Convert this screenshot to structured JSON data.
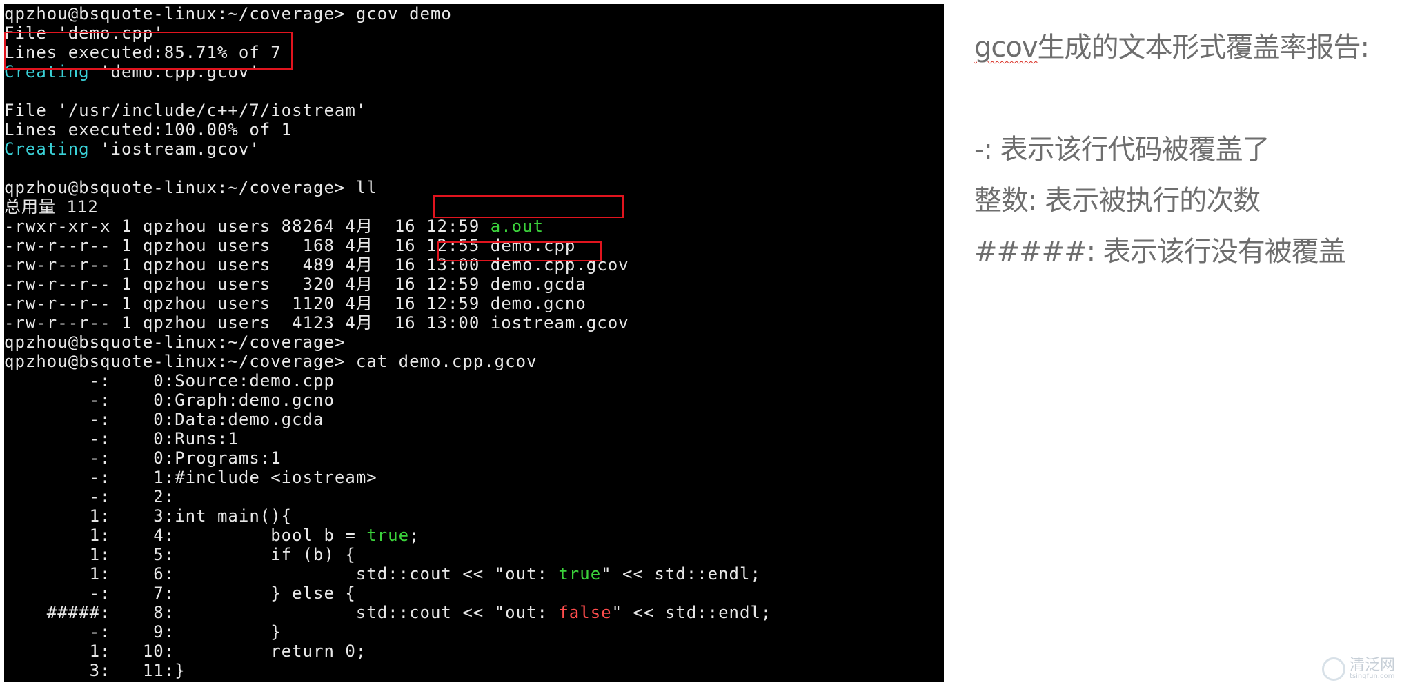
{
  "terminal": {
    "lines": [
      [
        {
          "t": "qpzhou@bsquote-linux:~/coverage> gcov demo",
          "c": "default"
        }
      ],
      [
        {
          "t": "File 'demo.cpp'",
          "c": "default"
        }
      ],
      [
        {
          "t": "Lines executed:85.71% of 7",
          "c": "default"
        }
      ],
      [
        {
          "t": "Creating",
          "c": "cyan"
        },
        {
          "t": " 'demo.cpp.gcov'",
          "c": "default"
        }
      ],
      [],
      [
        {
          "t": "File '/usr/include/c++/7/iostream'",
          "c": "default"
        }
      ],
      [
        {
          "t": "Lines executed:100.00% of 1",
          "c": "default"
        }
      ],
      [
        {
          "t": "Creating",
          "c": "cyan"
        },
        {
          "t": " 'iostream.gcov'",
          "c": "default"
        }
      ],
      [],
      [
        {
          "t": "qpzhou@bsquote-linux:~/coverage> ll",
          "c": "default"
        }
      ],
      [
        {
          "t": "总用量 112",
          "c": "default"
        }
      ],
      [
        {
          "t": "-rwxr-xr-x 1 qpzhou users 88264 4月  16 12:59 ",
          "c": "default"
        },
        {
          "t": "a.out",
          "c": "green"
        }
      ],
      [
        {
          "t": "-rw-r--r-- 1 qpzhou users   168 4月  16 12:55 demo.cpp",
          "c": "default"
        }
      ],
      [
        {
          "t": "-rw-r--r-- 1 qpzhou users   489 4月  16 13:00 demo.cpp.gcov",
          "c": "default"
        }
      ],
      [
        {
          "t": "-rw-r--r-- 1 qpzhou users   320 4月  16 12:59 demo.gcda",
          "c": "default"
        }
      ],
      [
        {
          "t": "-rw-r--r-- 1 qpzhou users  1120 4月  16 12:59 demo.gcno",
          "c": "default"
        }
      ],
      [
        {
          "t": "-rw-r--r-- 1 qpzhou users  4123 4月  16 13:00 iostream.gcov",
          "c": "default"
        }
      ],
      [
        {
          "t": "qpzhou@bsquote-linux:~/coverage>",
          "c": "default"
        }
      ],
      [
        {
          "t": "qpzhou@bsquote-linux:~/coverage> cat demo.cpp.gcov",
          "c": "default"
        }
      ],
      [
        {
          "t": "        -:    0:Source:demo.cpp",
          "c": "default"
        }
      ],
      [
        {
          "t": "        -:    0:Graph:demo.gcno",
          "c": "default"
        }
      ],
      [
        {
          "t": "        -:    0:Data:demo.gcda",
          "c": "default"
        }
      ],
      [
        {
          "t": "        -:    0:Runs:1",
          "c": "default"
        }
      ],
      [
        {
          "t": "        -:    0:Programs:1",
          "c": "default"
        }
      ],
      [
        {
          "t": "        -:    1:#include <iostream>",
          "c": "default"
        }
      ],
      [
        {
          "t": "        -:    2:",
          "c": "default"
        }
      ],
      [
        {
          "t": "        1:    3:int main(){",
          "c": "default"
        }
      ],
      [
        {
          "t": "        1:    4:         bool b = ",
          "c": "default"
        },
        {
          "t": "true",
          "c": "green"
        },
        {
          "t": ";",
          "c": "default"
        }
      ],
      [
        {
          "t": "        1:    5:         if (b) {",
          "c": "default"
        }
      ],
      [
        {
          "t": "        1:    6:                 std::cout << \"out: ",
          "c": "default"
        },
        {
          "t": "true",
          "c": "green"
        },
        {
          "t": "\" << std::endl;",
          "c": "default"
        }
      ],
      [
        {
          "t": "        -:    7:         } else {",
          "c": "default"
        }
      ],
      [
        {
          "t": "    #####:    8:                 std::cout << \"out: ",
          "c": "default"
        },
        {
          "t": "false",
          "c": "red"
        },
        {
          "t": "\" << std::endl;",
          "c": "default"
        }
      ],
      [
        {
          "t": "        -:    9:         }",
          "c": "default"
        }
      ],
      [
        {
          "t": "        1:   10:         return 0;",
          "c": "default"
        }
      ],
      [
        {
          "t": "        3:   11:}",
          "c": "default"
        }
      ]
    ]
  },
  "notes": {
    "title_prefix": "gcov",
    "title_rest": "生成的文本形式覆盖率报告:",
    "item1": "-:  表示该行代码被覆盖了",
    "item2": "整数:  表示被执行的次数",
    "item3": "#####: 表示该行没有被覆盖"
  },
  "watermark": {
    "cn": "清泛网",
    "en": "tsingfun.com"
  },
  "colors": {
    "terminal_bg": "#000000",
    "cyan": "#3ad1d7",
    "green": "#3bd23b",
    "red": "#ff4d4d",
    "highlight_box": "#e0141e",
    "note_text": "#6e6e6e"
  }
}
